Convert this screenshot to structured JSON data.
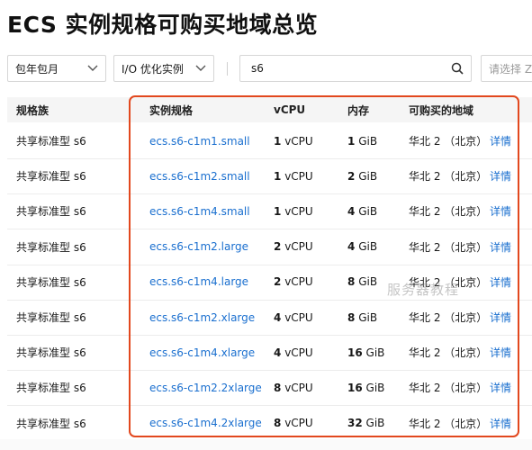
{
  "page": {
    "title": "ECS 实例规格可购买地域总览"
  },
  "filters": {
    "billing": "包年包月",
    "io": "I/O 优化实例",
    "search_value": "s6",
    "region_placeholder": "请选择 Z"
  },
  "table": {
    "headers": {
      "family": "规格族",
      "spec": "实例规格",
      "vcpu": "vCPU",
      "memory": "内存",
      "regions": "可购买的地域"
    },
    "rows": [
      {
        "family": "共享标准型 s6",
        "spec": "ecs.s6-c1m1.small",
        "vcpu_n": "1",
        "vcpu_u": "vCPU",
        "mem_n": "1",
        "mem_u": "GiB",
        "region": "华北 2 （北京）",
        "action": "详情"
      },
      {
        "family": "共享标准型 s6",
        "spec": "ecs.s6-c1m2.small",
        "vcpu_n": "1",
        "vcpu_u": "vCPU",
        "mem_n": "2",
        "mem_u": "GiB",
        "region": "华北 2 （北京）",
        "action": "详情"
      },
      {
        "family": "共享标准型 s6",
        "spec": "ecs.s6-c1m4.small",
        "vcpu_n": "1",
        "vcpu_u": "vCPU",
        "mem_n": "4",
        "mem_u": "GiB",
        "region": "华北 2 （北京）",
        "action": "详情"
      },
      {
        "family": "共享标准型 s6",
        "spec": "ecs.s6-c1m2.large",
        "vcpu_n": "2",
        "vcpu_u": "vCPU",
        "mem_n": "4",
        "mem_u": "GiB",
        "region": "华北 2 （北京）",
        "action": "详情"
      },
      {
        "family": "共享标准型 s6",
        "spec": "ecs.s6-c1m4.large",
        "vcpu_n": "2",
        "vcpu_u": "vCPU",
        "mem_n": "8",
        "mem_u": "GiB",
        "region": "华北 2 （北京）",
        "action": "详情"
      },
      {
        "family": "共享标准型 s6",
        "spec": "ecs.s6-c1m2.xlarge",
        "vcpu_n": "4",
        "vcpu_u": "vCPU",
        "mem_n": "8",
        "mem_u": "GiB",
        "region": "华北 2 （北京）",
        "action": "详情"
      },
      {
        "family": "共享标准型 s6",
        "spec": "ecs.s6-c1m4.xlarge",
        "vcpu_n": "4",
        "vcpu_u": "vCPU",
        "mem_n": "16",
        "mem_u": "GiB",
        "region": "华北 2 （北京）",
        "action": "详情"
      },
      {
        "family": "共享标准型 s6",
        "spec": "ecs.s6-c1m2.2xlarge",
        "vcpu_n": "8",
        "vcpu_u": "vCPU",
        "mem_n": "16",
        "mem_u": "GiB",
        "region": "华北 2 （北京）",
        "action": "详情"
      },
      {
        "family": "共享标准型 s6",
        "spec": "ecs.s6-c1m4.2xlarge",
        "vcpu_n": "8",
        "vcpu_u": "vCPU",
        "mem_n": "32",
        "mem_u": "GiB",
        "region": "华北 2 （北京）",
        "action": "详情"
      }
    ]
  },
  "watermark": "服务器教程",
  "colors": {
    "link": "#1a6fcf",
    "highlight_box": "#e2481e",
    "header_bg": "#f5f5f5"
  }
}
